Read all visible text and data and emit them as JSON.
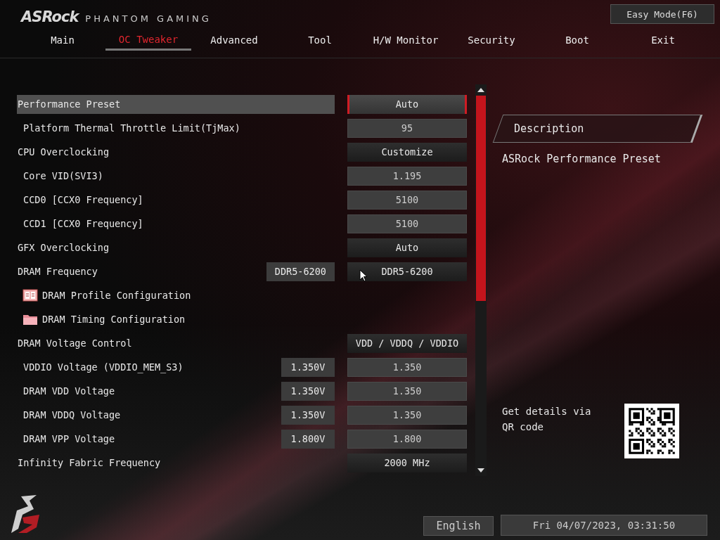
{
  "brand": {
    "logo": "ASRock",
    "subtitle": "PHANTOM GAMING"
  },
  "easy_mode_button": "Easy Mode(F6)",
  "tabs": [
    {
      "label": "Main",
      "selected": false
    },
    {
      "label": "OC Tweaker",
      "selected": true
    },
    {
      "label": "Advanced",
      "selected": false
    },
    {
      "label": "Tool",
      "selected": false
    },
    {
      "label": "H/W Monitor",
      "selected": false
    },
    {
      "label": "Security",
      "selected": false
    },
    {
      "label": "Boot",
      "selected": false
    },
    {
      "label": "Exit",
      "selected": false
    }
  ],
  "settings": [
    {
      "kind": "setting",
      "label": "Performance Preset",
      "selected": true,
      "option": {
        "kind": "select",
        "value": "Auto"
      },
      "children": [
        {
          "kind": "setting",
          "label": "Platform Thermal Throttle Limit(TjMax)",
          "selected": false,
          "option": {
            "kind": "number",
            "value": "95"
          }
        }
      ]
    },
    {
      "kind": "setting",
      "label": "CPU Overclocking",
      "selected": false,
      "option": {
        "kind": "select",
        "value": "Customize"
      },
      "children": [
        {
          "kind": "setting",
          "label": "Core VID(SVI3)",
          "selected": false,
          "option": {
            "kind": "number",
            "value": "1.195"
          }
        },
        {
          "kind": "setting",
          "label": "CCD0 [CCX0 Frequency]",
          "selected": false,
          "option": {
            "kind": "number",
            "value": "5100"
          }
        },
        {
          "kind": "setting",
          "label": "CCD1 [CCX0 Frequency]",
          "selected": false,
          "option": {
            "kind": "number",
            "value": "5100"
          }
        }
      ]
    },
    {
      "kind": "setting",
      "label": "GFX Overclocking",
      "selected": false,
      "option": {
        "kind": "select",
        "value": "Auto"
      }
    },
    {
      "kind": "setting",
      "label": "DRAM Frequency",
      "selected": false,
      "current": "DDR5-6200",
      "option": {
        "kind": "select",
        "value": "DDR5-6200"
      }
    },
    {
      "kind": "submenu",
      "label": "DRAM Profile Configuration",
      "selected": false
    },
    {
      "kind": "submenu",
      "label": "DRAM Timing Configuration",
      "selected": false
    },
    {
      "kind": "setting",
      "label": "DRAM Voltage Control",
      "selected": false,
      "option": {
        "kind": "select",
        "value": "VDD / VDDQ / VDDIO"
      },
      "children": [
        {
          "kind": "setting",
          "label": "VDDIO Voltage (VDDIO_MEM_S3)",
          "selected": false,
          "current": "1.350V",
          "option": {
            "kind": "number",
            "value": "1.350"
          }
        },
        {
          "kind": "setting",
          "label": "DRAM VDD Voltage",
          "selected": false,
          "current": "1.350V",
          "option": {
            "kind": "number",
            "value": "1.350"
          }
        },
        {
          "kind": "setting",
          "label": "DRAM VDDQ Voltage",
          "selected": false,
          "current": "1.350V",
          "option": {
            "kind": "number",
            "value": "1.350"
          }
        },
        {
          "kind": "setting",
          "label": "DRAM VPP Voltage",
          "selected": false,
          "current": "1.800V",
          "option": {
            "kind": "number",
            "value": "1.800"
          }
        }
      ]
    },
    {
      "kind": "setting",
      "label": "Infinity Fabric Frequency",
      "selected": false,
      "option": {
        "kind": "select",
        "value": "2000 MHz"
      }
    }
  ],
  "description": {
    "title": "Description",
    "text": "ASRock Performance Preset"
  },
  "qr": {
    "text": "Get details via QR code"
  },
  "footer": {
    "language": "English",
    "datetime": "Fri 04/07/2023, 03:31:50"
  }
}
